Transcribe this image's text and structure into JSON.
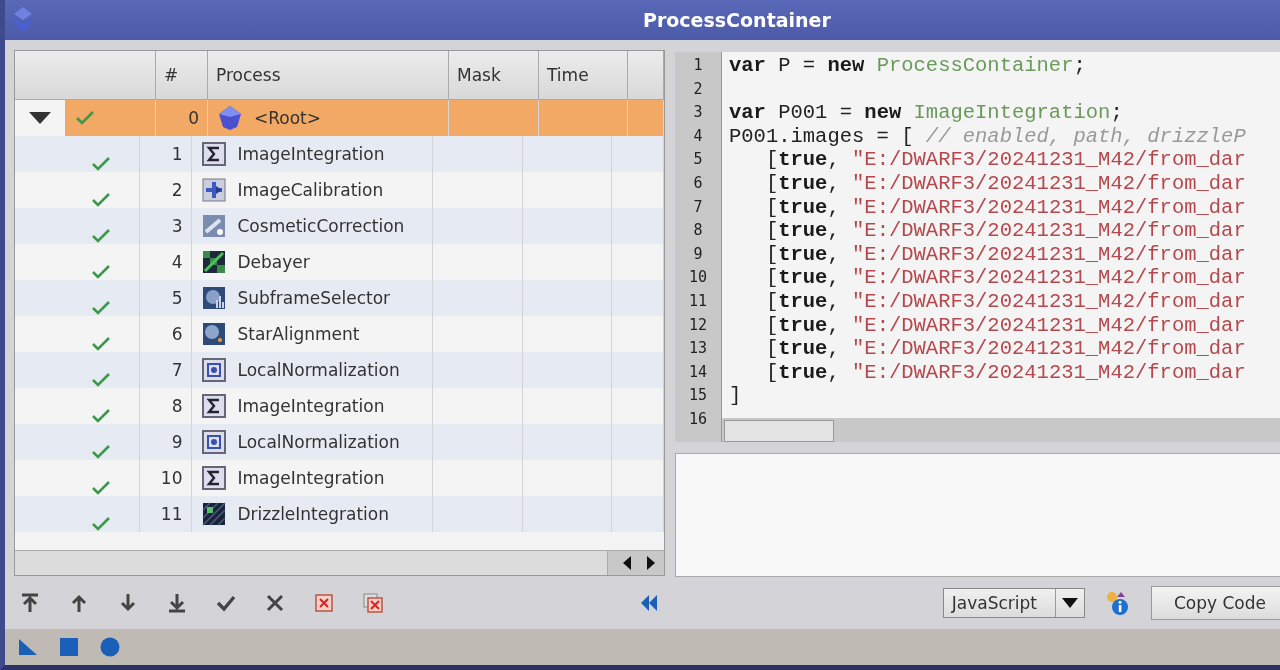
{
  "window": {
    "title": "ProcessContainer"
  },
  "table": {
    "columns": [
      "#",
      "Process",
      "Mask",
      "Time"
    ],
    "rows": [
      {
        "expanded": true,
        "checked": true,
        "number": "0",
        "process": "<Root>",
        "kind": "root",
        "selected": true
      },
      {
        "checked": true,
        "number": "1",
        "process": "ImageIntegration",
        "kind": "sigma",
        "selected": false
      },
      {
        "checked": true,
        "number": "2",
        "process": "ImageCalibration",
        "kind": "calibration",
        "selected": false
      },
      {
        "checked": true,
        "number": "3",
        "process": "CosmeticCorrection",
        "kind": "cosmetic",
        "selected": false
      },
      {
        "checked": true,
        "number": "4",
        "process": "Debayer",
        "kind": "debayer",
        "selected": false
      },
      {
        "checked": true,
        "number": "5",
        "process": "SubframeSelector",
        "kind": "subframe",
        "selected": false
      },
      {
        "checked": true,
        "number": "6",
        "process": "StarAlignment",
        "kind": "star",
        "selected": false
      },
      {
        "checked": true,
        "number": "7",
        "process": "LocalNormalization",
        "kind": "grid",
        "selected": false
      },
      {
        "checked": true,
        "number": "8",
        "process": "ImageIntegration",
        "kind": "sigma",
        "selected": false
      },
      {
        "checked": true,
        "number": "9",
        "process": "LocalNormalization",
        "kind": "grid",
        "selected": false
      },
      {
        "checked": true,
        "number": "10",
        "process": "ImageIntegration",
        "kind": "sigma",
        "selected": false
      },
      {
        "checked": true,
        "number": "11",
        "process": "DrizzleIntegration",
        "kind": "drizzle",
        "selected": false
      }
    ]
  },
  "code": {
    "lines": [
      {
        "number": "1",
        "tokens": [
          {
            "kind": "keyword",
            "text": "var"
          },
          {
            "kind": "plain",
            "text": " P = "
          },
          {
            "kind": "keyword",
            "text": "new"
          },
          {
            "kind": "class",
            "text": " ProcessContainer"
          },
          {
            "kind": "plain",
            "text": ";"
          }
        ]
      },
      {
        "number": "2"
      },
      {
        "number": "3",
        "tokens": [
          {
            "kind": "keyword",
            "text": "var"
          },
          {
            "kind": "plain",
            "text": " P001 = "
          },
          {
            "kind": "keyword",
            "text": "new"
          },
          {
            "kind": "class",
            "text": " ImageIntegration"
          },
          {
            "kind": "plain",
            "text": ";"
          }
        ]
      },
      {
        "number": "4",
        "tokens": [
          {
            "kind": "plain",
            "text": "P001.images = [ "
          },
          {
            "kind": "comment",
            "text": "// enabled, path, drizzleP"
          }
        ]
      },
      {
        "number": "5",
        "tokens": [
          {
            "kind": "plain",
            "text": "   ["
          },
          {
            "kind": "keyword",
            "text": "true"
          },
          {
            "kind": "plain",
            "text": ", "
          },
          {
            "kind": "string",
            "text": "\"E:/DWARF3/20241231_M42/from_dar"
          }
        ]
      },
      {
        "number": "6",
        "tokens": [
          {
            "kind": "plain",
            "text": "   ["
          },
          {
            "kind": "keyword",
            "text": "true"
          },
          {
            "kind": "plain",
            "text": ", "
          },
          {
            "kind": "string",
            "text": "\"E:/DWARF3/20241231_M42/from_dar"
          }
        ]
      },
      {
        "number": "7",
        "tokens": [
          {
            "kind": "plain",
            "text": "   ["
          },
          {
            "kind": "keyword",
            "text": "true"
          },
          {
            "kind": "plain",
            "text": ", "
          },
          {
            "kind": "string",
            "text": "\"E:/DWARF3/20241231_M42/from_dar"
          }
        ]
      },
      {
        "number": "8",
        "tokens": [
          {
            "kind": "plain",
            "text": "   ["
          },
          {
            "kind": "keyword",
            "text": "true"
          },
          {
            "kind": "plain",
            "text": ", "
          },
          {
            "kind": "string",
            "text": "\"E:/DWARF3/20241231_M42/from_dar"
          }
        ]
      },
      {
        "number": "9",
        "tokens": [
          {
            "kind": "plain",
            "text": "   ["
          },
          {
            "kind": "keyword",
            "text": "true"
          },
          {
            "kind": "plain",
            "text": ", "
          },
          {
            "kind": "string",
            "text": "\"E:/DWARF3/20241231_M42/from_dar"
          }
        ]
      },
      {
        "number": "10",
        "tokens": [
          {
            "kind": "plain",
            "text": "   ["
          },
          {
            "kind": "keyword",
            "text": "true"
          },
          {
            "kind": "plain",
            "text": ", "
          },
          {
            "kind": "string",
            "text": "\"E:/DWARF3/20241231_M42/from_dar"
          }
        ]
      },
      {
        "number": "11",
        "tokens": [
          {
            "kind": "plain",
            "text": "   ["
          },
          {
            "kind": "keyword",
            "text": "true"
          },
          {
            "kind": "plain",
            "text": ", "
          },
          {
            "kind": "string",
            "text": "\"E:/DWARF3/20241231_M42/from_dar"
          }
        ]
      },
      {
        "number": "12",
        "tokens": [
          {
            "kind": "plain",
            "text": "   ["
          },
          {
            "kind": "keyword",
            "text": "true"
          },
          {
            "kind": "plain",
            "text": ", "
          },
          {
            "kind": "string",
            "text": "\"E:/DWARF3/20241231_M42/from_dar"
          }
        ]
      },
      {
        "number": "13",
        "tokens": [
          {
            "kind": "plain",
            "text": "   ["
          },
          {
            "kind": "keyword",
            "text": "true"
          },
          {
            "kind": "plain",
            "text": ", "
          },
          {
            "kind": "string",
            "text": "\"E:/DWARF3/20241231_M42/from_dar"
          }
        ]
      },
      {
        "number": "14",
        "tokens": [
          {
            "kind": "plain",
            "text": "   ["
          },
          {
            "kind": "keyword",
            "text": "true"
          },
          {
            "kind": "plain",
            "text": ", "
          },
          {
            "kind": "string",
            "text": "\"E:/DWARF3/20241231_M42/from_dar"
          }
        ]
      },
      {
        "number": "15",
        "tokens": [
          {
            "kind": "plain",
            "text": "]"
          }
        ]
      },
      {
        "number": "16"
      }
    ]
  },
  "language_select": {
    "value": "JavaScript"
  },
  "copy_button": {
    "label": "Copy Code"
  }
}
